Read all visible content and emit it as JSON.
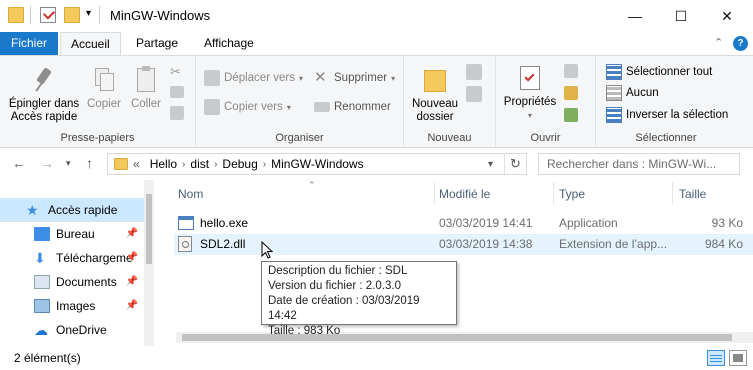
{
  "window": {
    "title": "MinGW-Windows",
    "minimize": "—",
    "maximize": "☐",
    "close": "✕"
  },
  "ribbon_tabs": [
    "Fichier",
    "Accueil",
    "Partage",
    "Affichage"
  ],
  "ribbon": {
    "presse_papiers": {
      "label": "Presse-papiers",
      "pin_label_1": "Épingler dans",
      "pin_label_2": "Accès rapide",
      "copy": "Copier",
      "paste": "Coller"
    },
    "organiser": {
      "label": "Organiser",
      "move_to": "Déplacer vers",
      "copy_to": "Copier vers",
      "delete": "Supprimer",
      "rename": "Renommer"
    },
    "nouveau": {
      "label": "Nouveau",
      "new_folder_1": "Nouveau",
      "new_folder_2": "dossier"
    },
    "ouvrir": {
      "label": "Ouvrir",
      "properties": "Propriétés"
    },
    "selectionner": {
      "label": "Sélectionner",
      "select_all": "Sélectionner tout",
      "select_none": "Aucun",
      "invert": "Inverser la sélection"
    }
  },
  "address": {
    "overflow": "«",
    "segments": [
      "Hello",
      "dist",
      "Debug",
      "MinGW-Windows"
    ],
    "search_placeholder": "Rechercher dans : MinGW-Wi..."
  },
  "nav_pane": {
    "items": [
      {
        "label": "Accès rapide",
        "icon": "star-icon",
        "pinned": false
      },
      {
        "label": "Bureau",
        "icon": "desktop-icon",
        "pinned": true
      },
      {
        "label": "Téléchargeme",
        "icon": "download-icon",
        "pinned": true
      },
      {
        "label": "Documents",
        "icon": "documents-icon",
        "pinned": true
      },
      {
        "label": "Images",
        "icon": "images-icon",
        "pinned": true
      },
      {
        "label": "OneDrive",
        "icon": "cloud-icon",
        "pinned": false
      }
    ]
  },
  "file_list": {
    "columns": [
      "Nom",
      "Modifié le",
      "Type",
      "Taille"
    ],
    "rows": [
      {
        "name": "hello.exe",
        "modified": "03/03/2019 14:41",
        "type": "Application",
        "size": "93 Ko",
        "icon": "exe-icon"
      },
      {
        "name": "SDL2.dll",
        "modified": "03/03/2019 14:38",
        "type": "Extension de l’app...",
        "size": "984 Ko",
        "icon": "dll-icon"
      }
    ]
  },
  "tooltip": {
    "lines": [
      "Description du fichier : SDL",
      "Version du fichier : 2.0.3.0",
      "Date de création : 03/03/2019 14:42",
      "Taille : 983 Ko"
    ]
  },
  "status": {
    "count": "2 élément(s)"
  },
  "colors": {
    "accent": "#1979ca",
    "selection": "#cce8ff",
    "hover": "#e5f3ff",
    "folder": "#f4c95c"
  }
}
